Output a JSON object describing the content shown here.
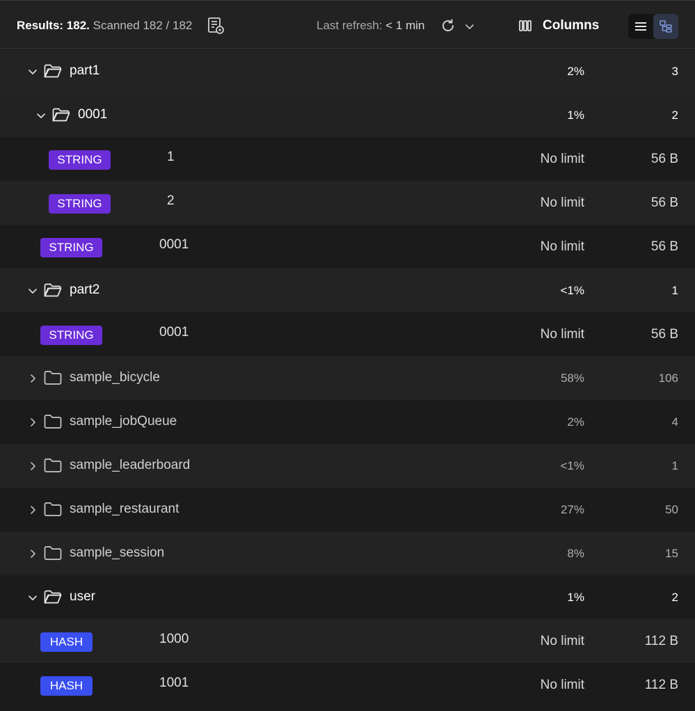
{
  "header": {
    "results_label": "Results: 182.",
    "scanned_label": "Scanned 182 / 182",
    "last_refresh_label": "Last refresh:",
    "last_refresh_value": "< 1 min",
    "columns_label": "Columns",
    "view_mode": "tree"
  },
  "rows": {
    "r0": {
      "name": "part1",
      "pct": "2%",
      "count": "3"
    },
    "r1": {
      "name": "0001",
      "pct": "1%",
      "count": "2"
    },
    "r2": {
      "type": "STRING",
      "key": "1",
      "ttl": "No limit",
      "size": "56 B"
    },
    "r3": {
      "type": "STRING",
      "key": "2",
      "ttl": "No limit",
      "size": "56 B"
    },
    "r4": {
      "type": "STRING",
      "key": "0001",
      "ttl": "No limit",
      "size": "56 B"
    },
    "r5": {
      "name": "part2",
      "pct": "<1%",
      "count": "1"
    },
    "r6": {
      "type": "STRING",
      "key": "0001",
      "ttl": "No limit",
      "size": "56 B"
    },
    "r7": {
      "name": "sample_bicycle",
      "pct": "58%",
      "count": "106"
    },
    "r8": {
      "name": "sample_jobQueue",
      "pct": "2%",
      "count": "4"
    },
    "r9": {
      "name": "sample_leaderboard",
      "pct": "<1%",
      "count": "1"
    },
    "r10": {
      "name": "sample_restaurant",
      "pct": "27%",
      "count": "50"
    },
    "r11": {
      "name": "sample_session",
      "pct": "8%",
      "count": "15"
    },
    "r12": {
      "name": "user",
      "pct": "1%",
      "count": "2"
    },
    "r13": {
      "type": "HASH",
      "key": "1000",
      "ttl": "No limit",
      "size": "112 B"
    },
    "r14": {
      "type": "HASH",
      "key": "1001",
      "ttl": "No limit",
      "size": "112 B"
    }
  }
}
